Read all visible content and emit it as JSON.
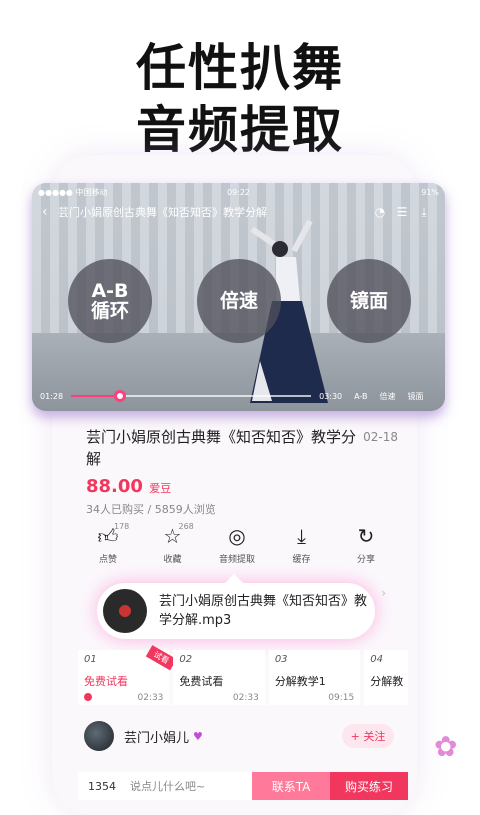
{
  "headline": {
    "line1": "任性扒舞",
    "line2": "音频提取"
  },
  "statusbar": {
    "carrier": "●●●●● 中国移动",
    "time": "09:22",
    "battery": "91%"
  },
  "player": {
    "title": "芸门小娟原创古典舞《知否知否》教学分解",
    "buttons": {
      "ab": "A-B\n循环",
      "speed": "倍速",
      "mirror": "镜面"
    },
    "current_time": "01:28",
    "total_time": "03:30",
    "progress": 0.2,
    "opts": [
      "A-B",
      "倍速",
      "镜面"
    ]
  },
  "product": {
    "title": "芸门小娟原创古典舞《知否知否》教学分解",
    "date": "02-18",
    "price": "88.00",
    "price_unit": "爱豆",
    "stats": "34人已购买 / 5859人浏览"
  },
  "actions": [
    {
      "label": "点赞",
      "count": "178",
      "icon": "thumb-up-icon"
    },
    {
      "label": "收藏",
      "count": "268",
      "icon": "star-icon"
    },
    {
      "label": "音频提取",
      "count": "",
      "icon": "audio-disc-icon"
    },
    {
      "label": "缓存",
      "count": "",
      "icon": "download-icon"
    },
    {
      "label": "分享",
      "count": "",
      "icon": "share-icon"
    }
  ],
  "popup": {
    "text": "芸门小娟原创古典舞《知否知否》教学分解.mp3"
  },
  "episodes": [
    {
      "num": "01",
      "name": "免费试看",
      "dur": "02:33",
      "tag": "试看"
    },
    {
      "num": "02",
      "name": "免费试看",
      "dur": "02:33"
    },
    {
      "num": "03",
      "name": "分解教学1",
      "dur": "09:15"
    },
    {
      "num": "04",
      "name": "分解教",
      "dur": ""
    }
  ],
  "author": {
    "name": "芸门小娟儿",
    "follow": "+ 关注"
  },
  "bottombar": {
    "count": "1354",
    "placeholder": "说点儿什么吧~",
    "contact": "联系TA",
    "buy": "购买练习"
  },
  "colors": {
    "accent": "#f2375e",
    "purple": "#c34bd8"
  }
}
